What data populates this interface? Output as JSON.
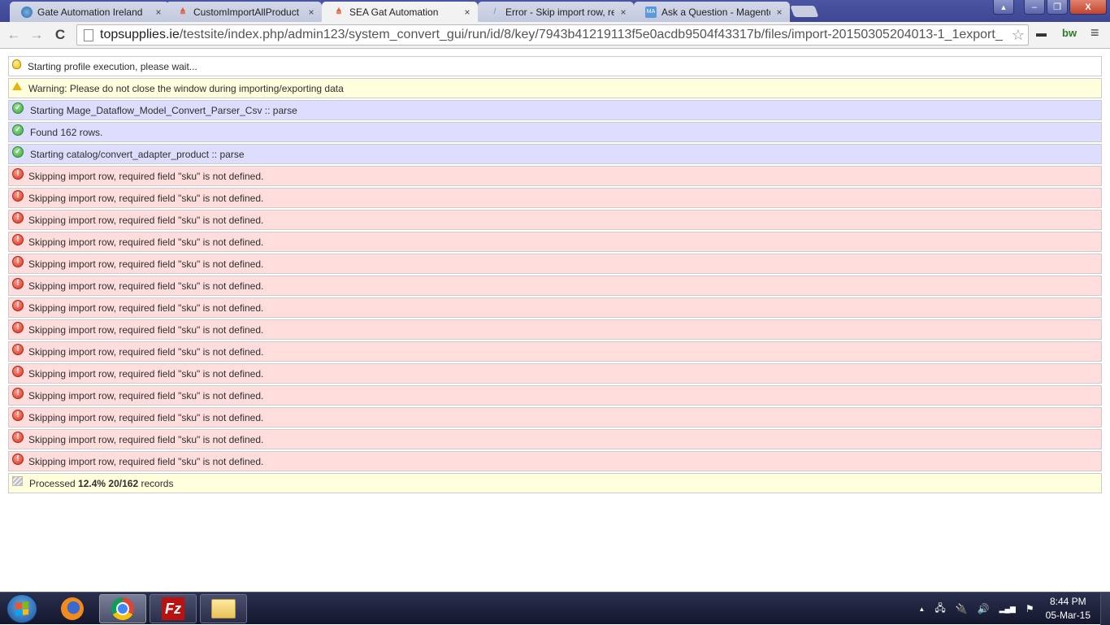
{
  "browser": {
    "tabs": [
      {
        "label": "Gate Automation Ireland",
        "icon": "globe-icon",
        "active": false
      },
      {
        "label": "CustomImportAllProduct",
        "icon": "magento-icon",
        "active": false
      },
      {
        "label": "SEA Gat Automation",
        "icon": "magento-icon",
        "active": true
      },
      {
        "label": "Error - Skip import row, re",
        "icon": "feather-icon",
        "active": false
      },
      {
        "label": "Ask a Question - Magento",
        "icon": "ma-icon",
        "active": false
      }
    ],
    "tab_close_glyph": "×",
    "favicon_text": {
      "magento": "⋔",
      "ma": "MA"
    },
    "window_buttons": {
      "user": "👤",
      "minimize": "–",
      "maximize": "❐",
      "close": "X"
    },
    "nav": {
      "back": "←",
      "forward": "→",
      "reload": "C"
    },
    "url": {
      "host": "topsupplies.ie",
      "path": "/testsite/index.php/admin123/system_convert_gui/run/id/8/key/7943b41219113f5e0acdb9504f43317b/files/import-20150305204013-1_1export_",
      "star": "☆"
    },
    "extensions": {
      "mask": "▬",
      "bw": "bw",
      "menu": "≡"
    }
  },
  "log": {
    "info": "Starting profile execution, please wait...",
    "warning": "Warning: Please do not close the window during importing/exporting data",
    "success": [
      "Starting Mage_Dataflow_Model_Convert_Parser_Csv :: parse",
      "Found 162 rows.",
      "Starting catalog/convert_adapter_product :: parse"
    ],
    "errors": [
      "Skipping import row, required field \"sku\" is not defined.",
      "Skipping import row, required field \"sku\" is not defined.",
      "Skipping import row, required field \"sku\" is not defined.",
      "Skipping import row, required field \"sku\" is not defined.",
      "Skipping import row, required field \"sku\" is not defined.",
      "Skipping import row, required field \"sku\" is not defined.",
      "Skipping import row, required field \"sku\" is not defined.",
      "Skipping import row, required field \"sku\" is not defined.",
      "Skipping import row, required field \"sku\" is not defined.",
      "Skipping import row, required field \"sku\" is not defined.",
      "Skipping import row, required field \"sku\" is not defined.",
      "Skipping import row, required field \"sku\" is not defined.",
      "Skipping import row, required field \"sku\" is not defined.",
      "Skipping import row, required field \"sku\" is not defined."
    ],
    "progress": {
      "prefix": "Processed",
      "percent": "12.4%",
      "count": "20/162",
      "suffix": "records"
    },
    "icon_glyphs": {
      "ok": "✓",
      "err": "!"
    },
    "colors": {
      "info_bg": "#ffffff",
      "warning_bg": "#ffffdd",
      "success_bg": "#ddddff",
      "error_bg": "#ffdddd",
      "border": "#cccccc"
    }
  },
  "taskbar": {
    "apps": [
      "start-button",
      "firefox",
      "chrome",
      "filezilla",
      "windows-explorer"
    ],
    "filezilla_label": "Fz",
    "tray": {
      "show_hidden": "▲",
      "network": "🖧",
      "power": "🔌",
      "volume": "🔊",
      "signal": "▂▄▆",
      "action_center": "⚑"
    },
    "time": "8:44 PM",
    "date": "05-Mar-15"
  }
}
